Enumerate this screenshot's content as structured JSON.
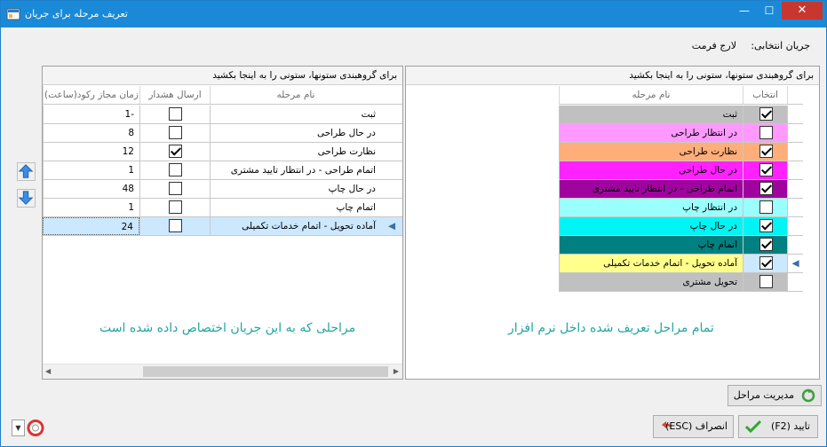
{
  "window": {
    "title": "تعریف مرحله برای جریان"
  },
  "flow": {
    "label": "جریان انتخابی:",
    "value": "لارج فرمت"
  },
  "left_panel": {
    "group_hint": "برای گروهبندی ستونها، ستونی را به اینجا بکشید",
    "columns": {
      "allowed_time": "زمان مجاز رکود(ساعت)",
      "send_alert": "ارسال هشدار",
      "stage_name": "نام مرحله"
    },
    "rows": [
      {
        "name": "ثبت",
        "alert": false,
        "time": "1-"
      },
      {
        "name": "در حال طراحی",
        "alert": false,
        "time": "8"
      },
      {
        "name": "نظارت طراحی",
        "alert": true,
        "time": "12"
      },
      {
        "name": "اتمام طراحی - در انتظار تایید مشتری",
        "alert": false,
        "time": "1"
      },
      {
        "name": "در حال چاپ",
        "alert": false,
        "time": "48"
      },
      {
        "name": "اتمام چاپ",
        "alert": false,
        "time": "1"
      },
      {
        "name": "آماده تحویل - اتمام خدمات تکمیلی",
        "alert": false,
        "time": "24"
      }
    ],
    "caption": "مراحلی که به این جریان اختصاص داده شده است"
  },
  "right_panel": {
    "group_hint": "برای گروهبندی ستونها، ستونی را به اینجا بکشید",
    "columns": {
      "select": "انتخاب",
      "stage_name": "نام مرحله"
    },
    "rows": [
      {
        "name": "ثبت",
        "selected": true,
        "color": "#c0c0c0"
      },
      {
        "name": "در انتظار طراحی",
        "selected": false,
        "color": "#ff99ff"
      },
      {
        "name": "نظارت طراحی",
        "selected": true,
        "color": "#ffae7a"
      },
      {
        "name": "در حال طراحی",
        "selected": true,
        "color": "#ff22ff"
      },
      {
        "name": "اتمام طراحی - در انتظار تایید مشتری",
        "selected": true,
        "color": "#a0049f"
      },
      {
        "name": "در انتظار چاپ",
        "selected": false,
        "color": "#9affff"
      },
      {
        "name": "در حال چاپ",
        "selected": true,
        "color": "#00f4f4"
      },
      {
        "name": "اتمام چاپ",
        "selected": true,
        "color": "#008080"
      },
      {
        "name": "آماده تحویل - اتمام خدمات تکمیلی",
        "selected": true,
        "color": "#ffff8c"
      },
      {
        "name": "تحویل مشتری",
        "selected": false,
        "color": "#c0c0c0"
      }
    ],
    "caption": "تمام مراحل تعریف شده داخل نرم افزار"
  },
  "buttons": {
    "manage_stages": "مدیریت مراحل",
    "confirm": "تایید (F2)",
    "cancel": "انصراف (ESC)"
  }
}
